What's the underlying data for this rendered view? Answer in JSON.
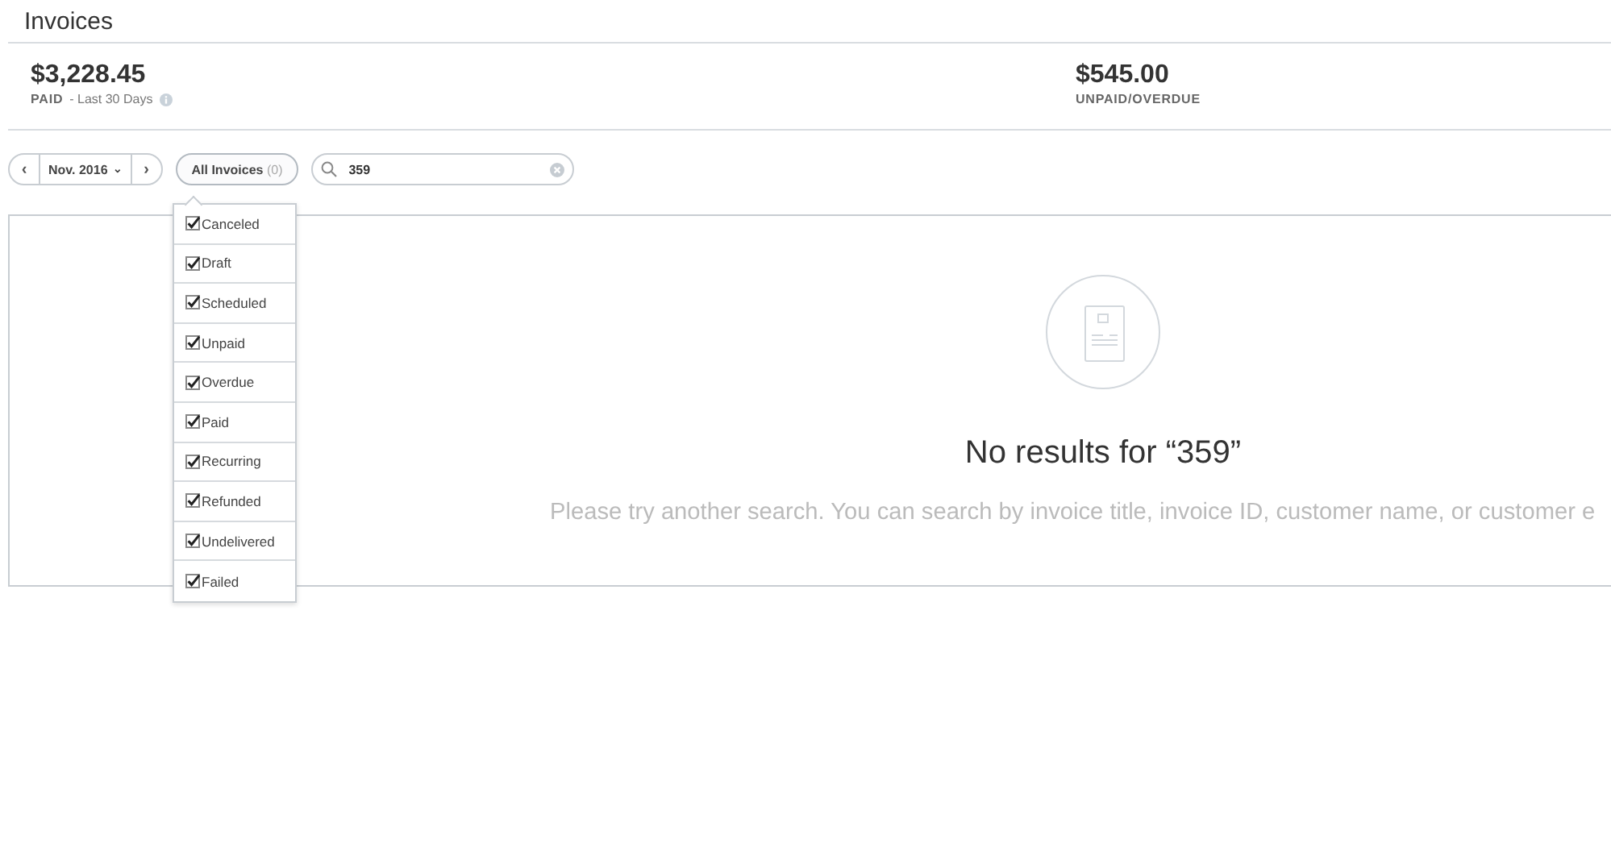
{
  "page": {
    "title": "Invoices"
  },
  "stats": [
    {
      "amount": "$3,228.45",
      "label": "PAID",
      "sublabel": "- Last 30 Days",
      "info": true
    },
    {
      "amount": "$545.00",
      "label": "UNPAID/OVERDUE",
      "info": false
    }
  ],
  "toolbar": {
    "prev": "‹",
    "period": "Nov. 2016",
    "period_caret": "⌄",
    "next": "›",
    "filter": {
      "label": "All Invoices",
      "count": "(0)",
      "expanded": true
    },
    "search": {
      "value": "359"
    }
  },
  "filter_menu": [
    {
      "label": "Canceled",
      "checked": true
    },
    {
      "label": "Draft",
      "checked": true
    },
    {
      "label": "Scheduled",
      "checked": true
    },
    {
      "label": "Unpaid",
      "checked": true
    },
    {
      "label": "Overdue",
      "checked": true
    },
    {
      "label": "Paid",
      "checked": true
    },
    {
      "label": "Recurring",
      "checked": true
    },
    {
      "label": "Refunded",
      "checked": true
    },
    {
      "label": "Undelivered",
      "checked": true
    },
    {
      "label": "Failed",
      "checked": true
    }
  ],
  "empty_state": {
    "title": "No results for “359”",
    "message": "Please try another search. You can search by invoice title, invoice ID, customer name, or customer e"
  }
}
